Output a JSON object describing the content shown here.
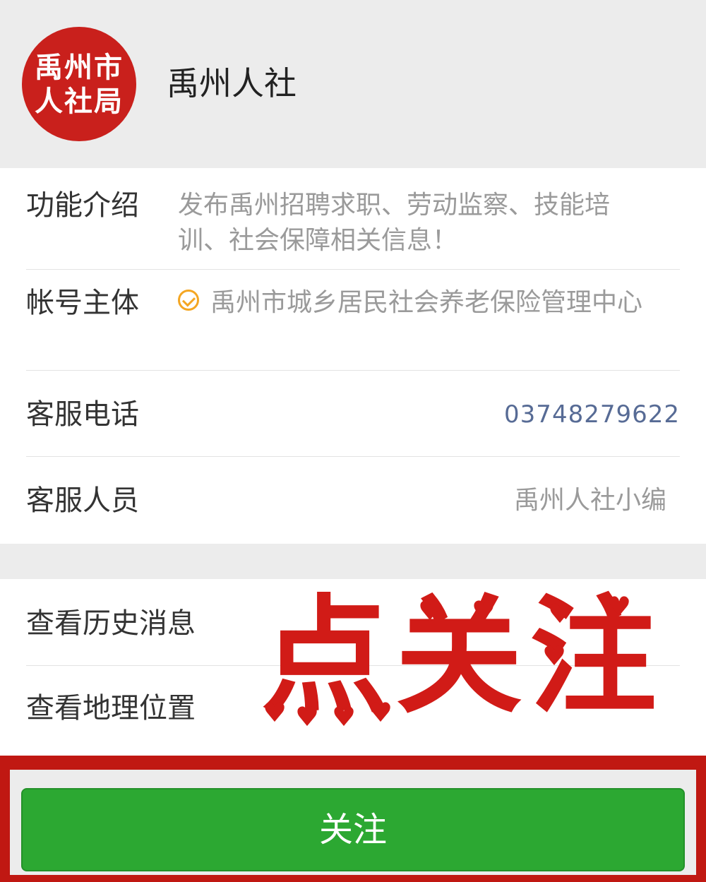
{
  "header": {
    "avatar_text_line1": "禹州市",
    "avatar_text_line2": "人社局",
    "account_name": "禹州人社"
  },
  "info": {
    "intro_label": "功能介绍",
    "intro_text": "发布禹州招聘求职、劳动监察、技能培训、社会保障相关信息！",
    "entity_label": "帐号主体",
    "entity_icon": "verified-check-icon",
    "entity_text": "禹州市城乡居民社会养老保险管理中心",
    "phone_label": "客服电话",
    "phone_value": "03748279622",
    "staff_label": "客服人员",
    "staff_value": "禹州人社小编"
  },
  "links": {
    "history": "查看历史消息",
    "location": "查看地理位置"
  },
  "overlay": {
    "text": "点关注",
    "color": "#d11b17"
  },
  "footer": {
    "follow_label": "关注",
    "button_color": "#2ca832"
  }
}
